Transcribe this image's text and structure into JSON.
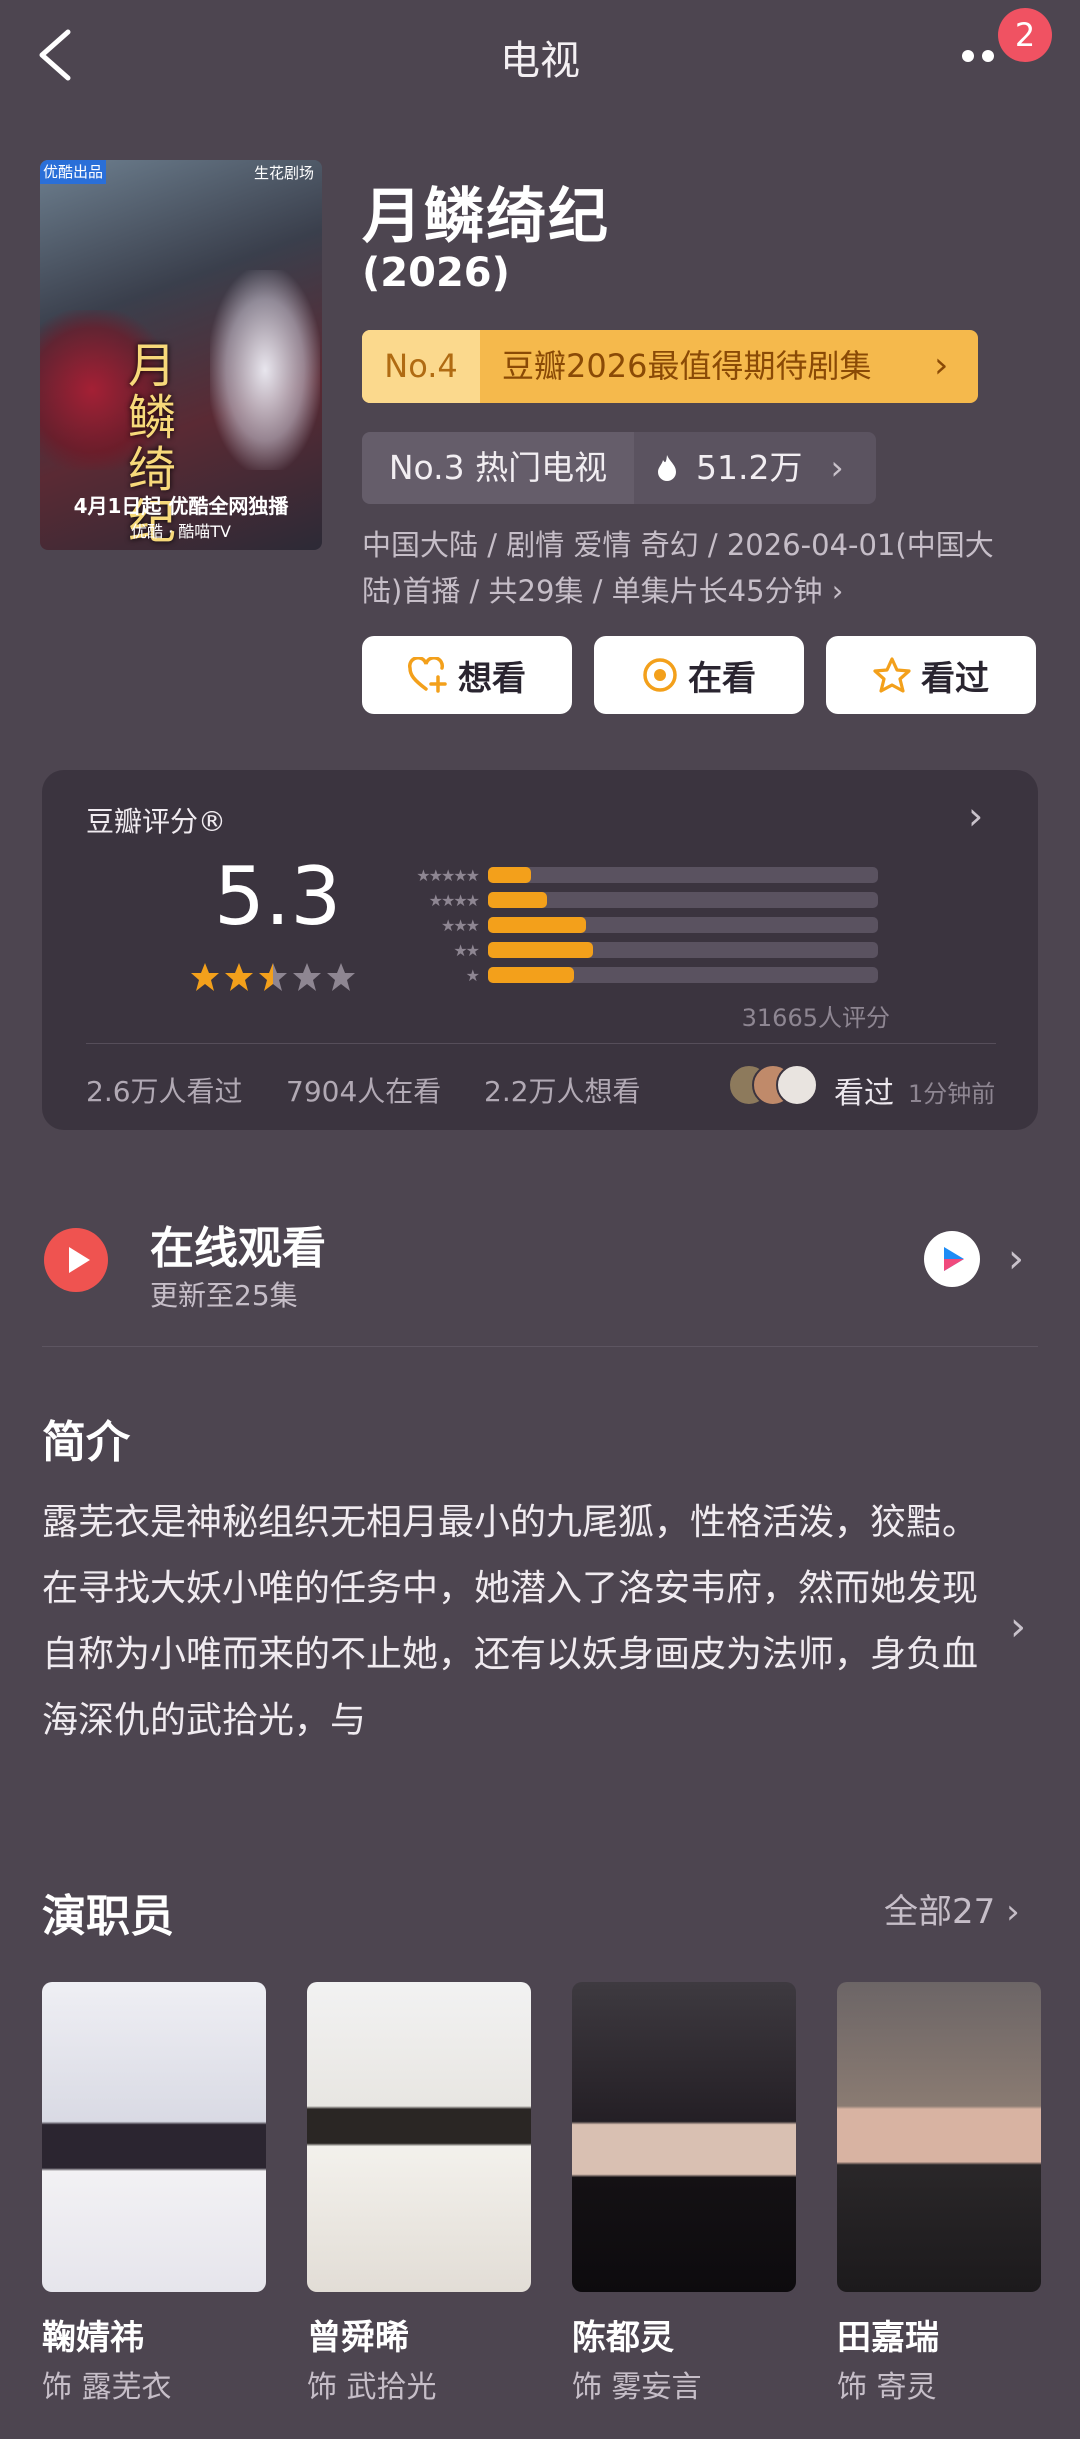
{
  "header": {
    "title": "电视",
    "badge": "2"
  },
  "poster": {
    "tag_left": "优酷出品",
    "tag_right": "生花剧场",
    "title_art": "月鳞绮纪",
    "date_line": "4月1日起 优酷全网独播",
    "platforms": "优酷 · 酷喵TV"
  },
  "show": {
    "title": "月鳞绮纪",
    "year": "(2026)",
    "rank_no": "No.4",
    "rank_label": "豆瓣2026最值得期待剧集",
    "hot_rank": "No.3 热门电视",
    "hot_value": "51.2万",
    "meta": "中国大陆 / 剧情 爱情 奇幻 / 2026-04-01(中国大陆)首播 / 共29集 / 单集片长45分钟 ›"
  },
  "actions": [
    {
      "label": "想看",
      "icon": "heart-plus-icon"
    },
    {
      "label": "在看",
      "icon": "target-icon"
    },
    {
      "label": "看过",
      "icon": "star-icon"
    }
  ],
  "rating": {
    "title": "豆瓣评分®",
    "score": "5.3",
    "stars": 2.5,
    "distribution": [
      {
        "stars": "★★★★★",
        "fraction": 0.11
      },
      {
        "stars": "★★★★",
        "fraction": 0.15
      },
      {
        "stars": "★★★",
        "fraction": 0.25
      },
      {
        "stars": "★★",
        "fraction": 0.27
      },
      {
        "stars": "★",
        "fraction": 0.22
      }
    ],
    "count": "31665人评分",
    "stat_seen": "2.6万人看过",
    "stat_watching": "7904人在看",
    "stat_want": "2.2万人想看",
    "friend_action": "看过",
    "friend_time": "1分钟前"
  },
  "online": {
    "title": "在线观看",
    "subtitle": "更新至25集",
    "platform_icon": "youku-icon"
  },
  "synopsis": {
    "title": "简介",
    "body": "露芜衣是神秘组织无相月最小的九尾狐，性格活泼，狡黠。在寻找大妖小唯的任务中，她潜入了洛安韦府，然而她发现自称为小唯而来的不止她，还有以妖身画皮为法师，身负血海深仇的武拾光，与"
  },
  "cast": {
    "title": "演职员",
    "all_label": "全部27 ›",
    "members": [
      {
        "name": "鞠婧祎",
        "role": "饰 露芜衣"
      },
      {
        "name": "曾舜晞",
        "role": "饰 武拾光"
      },
      {
        "name": "陈都灵",
        "role": "饰 雾妄言"
      },
      {
        "name": "田嘉瑞",
        "role": "饰 寄灵"
      }
    ]
  },
  "colors": {
    "background": "#4d4550",
    "accent": "#f3a01b",
    "card": "#3b343f",
    "play": "#ef5350"
  }
}
